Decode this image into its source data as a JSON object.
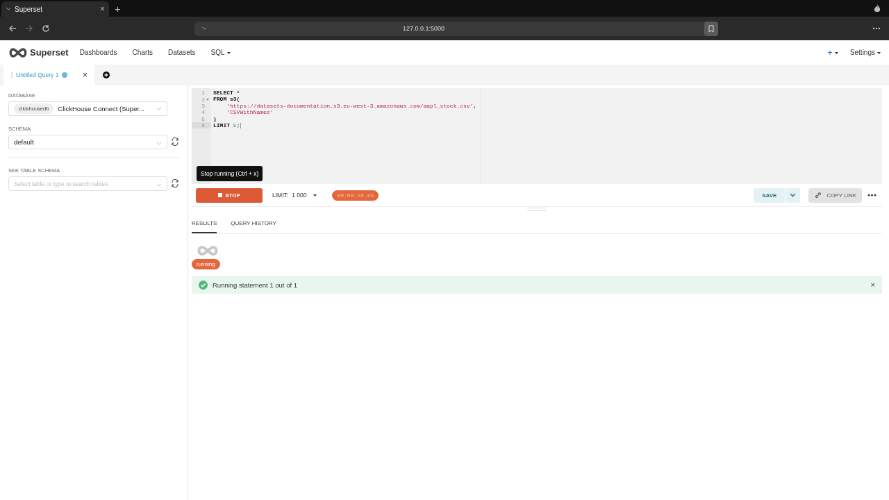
{
  "browser": {
    "tab_title": "Superset",
    "tab_close": "×",
    "new_tab": "+",
    "url": "127.0.0.1:5000"
  },
  "navbar": {
    "brand": "Superset",
    "items": [
      {
        "label": "Dashboards",
        "dropdown": false
      },
      {
        "label": "Charts",
        "dropdown": false
      },
      {
        "label": "Datasets",
        "dropdown": false
      },
      {
        "label": "SQL",
        "dropdown": true
      }
    ],
    "plus": "+",
    "settings": "Settings"
  },
  "query_tabs": [
    {
      "label": "Untitled Query 1",
      "selected": true,
      "running": true,
      "close": "×"
    }
  ],
  "sidebar": {
    "database_label": "DATABASE",
    "database_tag": "clickhousedb",
    "database_value": "ClickHouse Connect (Super...",
    "schema_label": "SCHEMA",
    "schema_value": "default",
    "table_label": "SEE TABLE SCHEMA",
    "table_placeholder": "Select table or type to search tables"
  },
  "editor": {
    "lines": [
      {
        "number": "1",
        "foldable": false,
        "active": false,
        "tokens": [
          {
            "kind": "keyword",
            "text": "SELECT *"
          }
        ]
      },
      {
        "number": "2",
        "foldable": true,
        "active": false,
        "tokens": [
          {
            "kind": "keyword",
            "text": "FROM s3("
          }
        ]
      },
      {
        "number": "3",
        "foldable": false,
        "active": false,
        "tokens": [
          {
            "kind": "string",
            "text": "    'https://datasets-documentation.s3.eu-west-3.amazonaws.com/aapl_stock.csv'"
          },
          {
            "kind": "plain",
            "text": ","
          }
        ]
      },
      {
        "number": "4",
        "foldable": false,
        "active": false,
        "tokens": [
          {
            "kind": "string",
            "text": "    'CSVWithNames'"
          }
        ]
      },
      {
        "number": "5",
        "foldable": false,
        "active": false,
        "tokens": [
          {
            "kind": "keyword",
            "text": ")"
          }
        ]
      },
      {
        "number": "6",
        "foldable": false,
        "active": true,
        "tokens": [
          {
            "kind": "keyword",
            "text": "LIMIT "
          },
          {
            "kind": "number",
            "text": "5"
          },
          {
            "kind": "plain",
            "text": ";"
          }
        ]
      }
    ]
  },
  "tooltip": "Stop running (Ctrl + x)",
  "toolbar": {
    "stop": "STOP",
    "limit_label": "LIMIT:",
    "limit_value": "1 000",
    "timer": "00:00:10.55",
    "save": "SAVE",
    "copy_link": "COPY LINK"
  },
  "result_tabs": [
    {
      "label": "RESULTS",
      "selected": true
    },
    {
      "label": "QUERY HISTORY",
      "selected": false
    }
  ],
  "status_badge": "running",
  "alert": {
    "text": "Running statement 1 out of 1",
    "close": "×"
  }
}
